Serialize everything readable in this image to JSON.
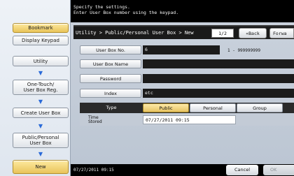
{
  "message": {
    "line1": "Specify the settings.",
    "line2": "Enter User Box number using the keypad."
  },
  "sidebar": {
    "bookmark": "Bookmark",
    "display_keypad": "Display Keypad",
    "steps": [
      "Utility",
      "One-Touch/\nUser Box Reg.",
      "Create User Box",
      "Public/Personal\nUser Box",
      "New"
    ]
  },
  "titlebar": {
    "path": "Utility > Public/Personal User Box > New",
    "page": "1/2",
    "back": "«Back",
    "next": "Forwa"
  },
  "form": {
    "user_box_no_label": "User Box No.",
    "user_box_no_value": "6",
    "user_box_no_range": "1 - 999999999",
    "user_box_name_label": "User Box Name",
    "user_box_name_value": "",
    "password_label": "Password",
    "password_value": "",
    "index_label": "Index",
    "index_value": "etc",
    "type_label": "Type",
    "type_options": [
      "Public",
      "Personal",
      "Group"
    ],
    "type_selected": "Public",
    "time_label_1": "Time",
    "time_label_2": "Stored",
    "time_value": "07/27/2011   09:15"
  },
  "bottom": {
    "clock": "07/27/2011   09:15",
    "cancel": "Cancel",
    "ok": "OK"
  },
  "colors": {
    "selected_gold": "#e8c463",
    "arrow_blue": "#2a6ad8",
    "background": "#c9d1dc"
  }
}
